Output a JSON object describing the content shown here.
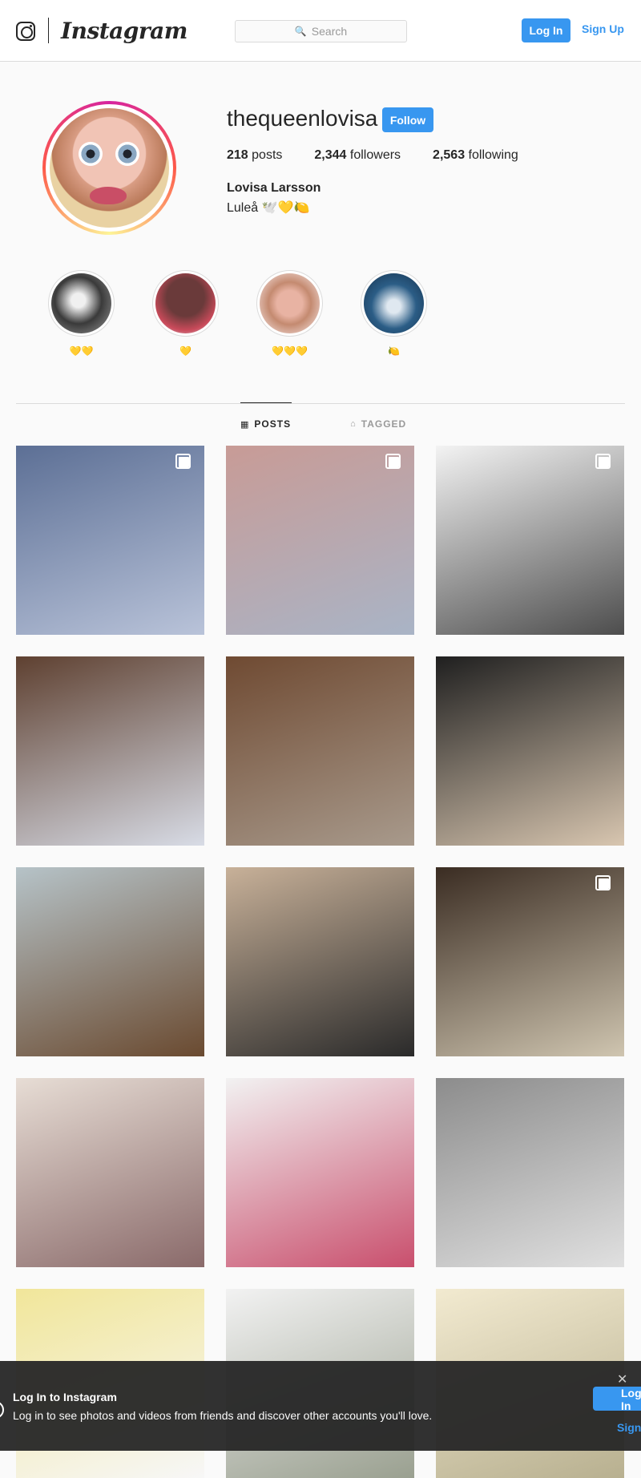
{
  "header": {
    "brand": "Instagram",
    "search_placeholder": "Search",
    "login_label": "Log In",
    "signup_label": "Sign Up"
  },
  "profile": {
    "username": "thequeenlovisa",
    "follow_label": "Follow",
    "posts_count": "218",
    "posts_label": "posts",
    "followers_count": "2,344",
    "followers_label": "followers",
    "following_count": "2,563",
    "following_label": "following",
    "full_name": "Lovisa Larsson",
    "bio": "Luleå 🕊️💛🍋"
  },
  "highlights": [
    {
      "label": "💛💛",
      "color": "#3a3a3a"
    },
    {
      "label": "💛",
      "color": "#8a3e3e"
    },
    {
      "label": "💛💛💛",
      "color": "#e8b3a3"
    },
    {
      "label": "🍋",
      "color": "#2b5d86"
    }
  ],
  "tabs": [
    {
      "label": "POSTS",
      "icon": "grid-icon",
      "active": true
    },
    {
      "label": "TAGGED",
      "icon": "tag-icon",
      "active": false
    }
  ],
  "posts": [
    {
      "multi": true,
      "colors": [
        "#5c6f95",
        "#b9c3d9"
      ]
    },
    {
      "multi": true,
      "colors": [
        "#c89b96",
        "#a9b4c6"
      ]
    },
    {
      "multi": true,
      "colors": [
        "#f3f3f3",
        "#4d4d4d"
      ]
    },
    {
      "multi": false,
      "colors": [
        "#5e4030",
        "#d8dce6"
      ]
    },
    {
      "multi": false,
      "colors": [
        "#6f4a32",
        "#a89a8c"
      ]
    },
    {
      "multi": false,
      "colors": [
        "#1f1f1f",
        "#d8c6b0"
      ]
    },
    {
      "multi": false,
      "colors": [
        "#b6c3c8",
        "#6a4a30"
      ]
    },
    {
      "multi": false,
      "colors": [
        "#c8b199",
        "#2a2a2a"
      ]
    },
    {
      "multi": true,
      "colors": [
        "#3a2c22",
        "#cfc5b0"
      ]
    },
    {
      "multi": false,
      "colors": [
        "#e7ddd5",
        "#8a6a6a"
      ]
    },
    {
      "multi": false,
      "colors": [
        "#f2f2f2",
        "#c94f6d"
      ]
    },
    {
      "multi": false,
      "colors": [
        "#8c8c8c",
        "#e0e0e0"
      ]
    },
    {
      "multi": false,
      "colors": [
        "#f1e69a",
        "#f7f7f7"
      ]
    },
    {
      "multi": false,
      "colors": [
        "#f2f2f2",
        "#9aa090"
      ]
    },
    {
      "multi": false,
      "colors": [
        "#f2ead0",
        "#b8b090"
      ]
    }
  ],
  "banner": {
    "title": "Log In to Instagram",
    "subtitle": "Log in to see photos and videos from friends and discover other accounts you'll love.",
    "login_label": "Log In",
    "signup_label": "Sign Up"
  }
}
